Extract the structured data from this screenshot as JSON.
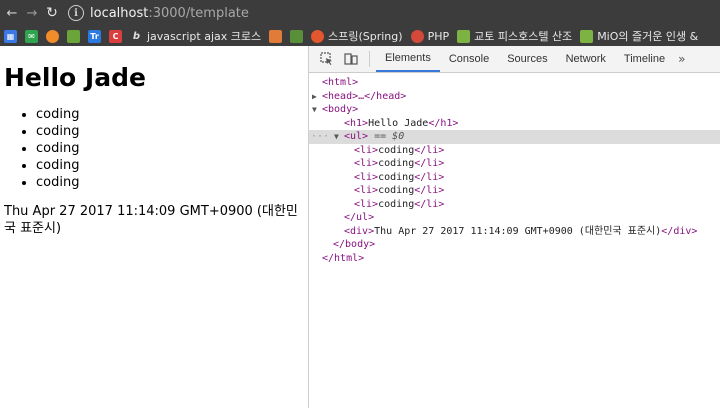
{
  "address_bar": {
    "url_host": "localhost",
    "url_rest": ":3000/template"
  },
  "bookmarks": [
    {
      "label": "javascript ajax 크로스",
      "icon": "javascript-bookmark-icon"
    },
    {
      "label": "스프링(Spring)",
      "icon": "spring-bookmark-icon"
    },
    {
      "label": "PHP",
      "icon": "php-bookmark-icon"
    },
    {
      "label": "교토 피스호스텔 산조",
      "icon": "rss-bookmark-icon"
    },
    {
      "label": "MiO의 즐거운 인생 &",
      "icon": "rss-bookmark-icon"
    }
  ],
  "page": {
    "heading": "Hello Jade",
    "items": [
      "coding",
      "coding",
      "coding",
      "coding",
      "coding"
    ],
    "date": "Thu Apr 27 2017 11:14:09 GMT+0900 (대한민국 표준시)"
  },
  "devtools": {
    "tabs": [
      "Elements",
      "Console",
      "Sources",
      "Network",
      "Timeline"
    ],
    "active_tab": "Elements",
    "more": "»",
    "tree": {
      "html_open": "<html>",
      "head": "<head>…</head>",
      "body_open": "<body>",
      "h1_open": "<h1>",
      "h1_text": "Hello Jade",
      "h1_close": "</h1>",
      "ul_open": "<ul>",
      "ul_eq": " == $0",
      "li_open": "<li>",
      "li_text": "coding",
      "li_close": "</li>",
      "ul_close": "</ul>",
      "div_open": "<div>",
      "div_text": "Thu Apr 27 2017 11:14:09 GMT+0900 (대한민국 표준시)",
      "div_close": "</div>",
      "body_close": "</body>",
      "html_close": "</html>",
      "selection_dots": "···"
    }
  }
}
